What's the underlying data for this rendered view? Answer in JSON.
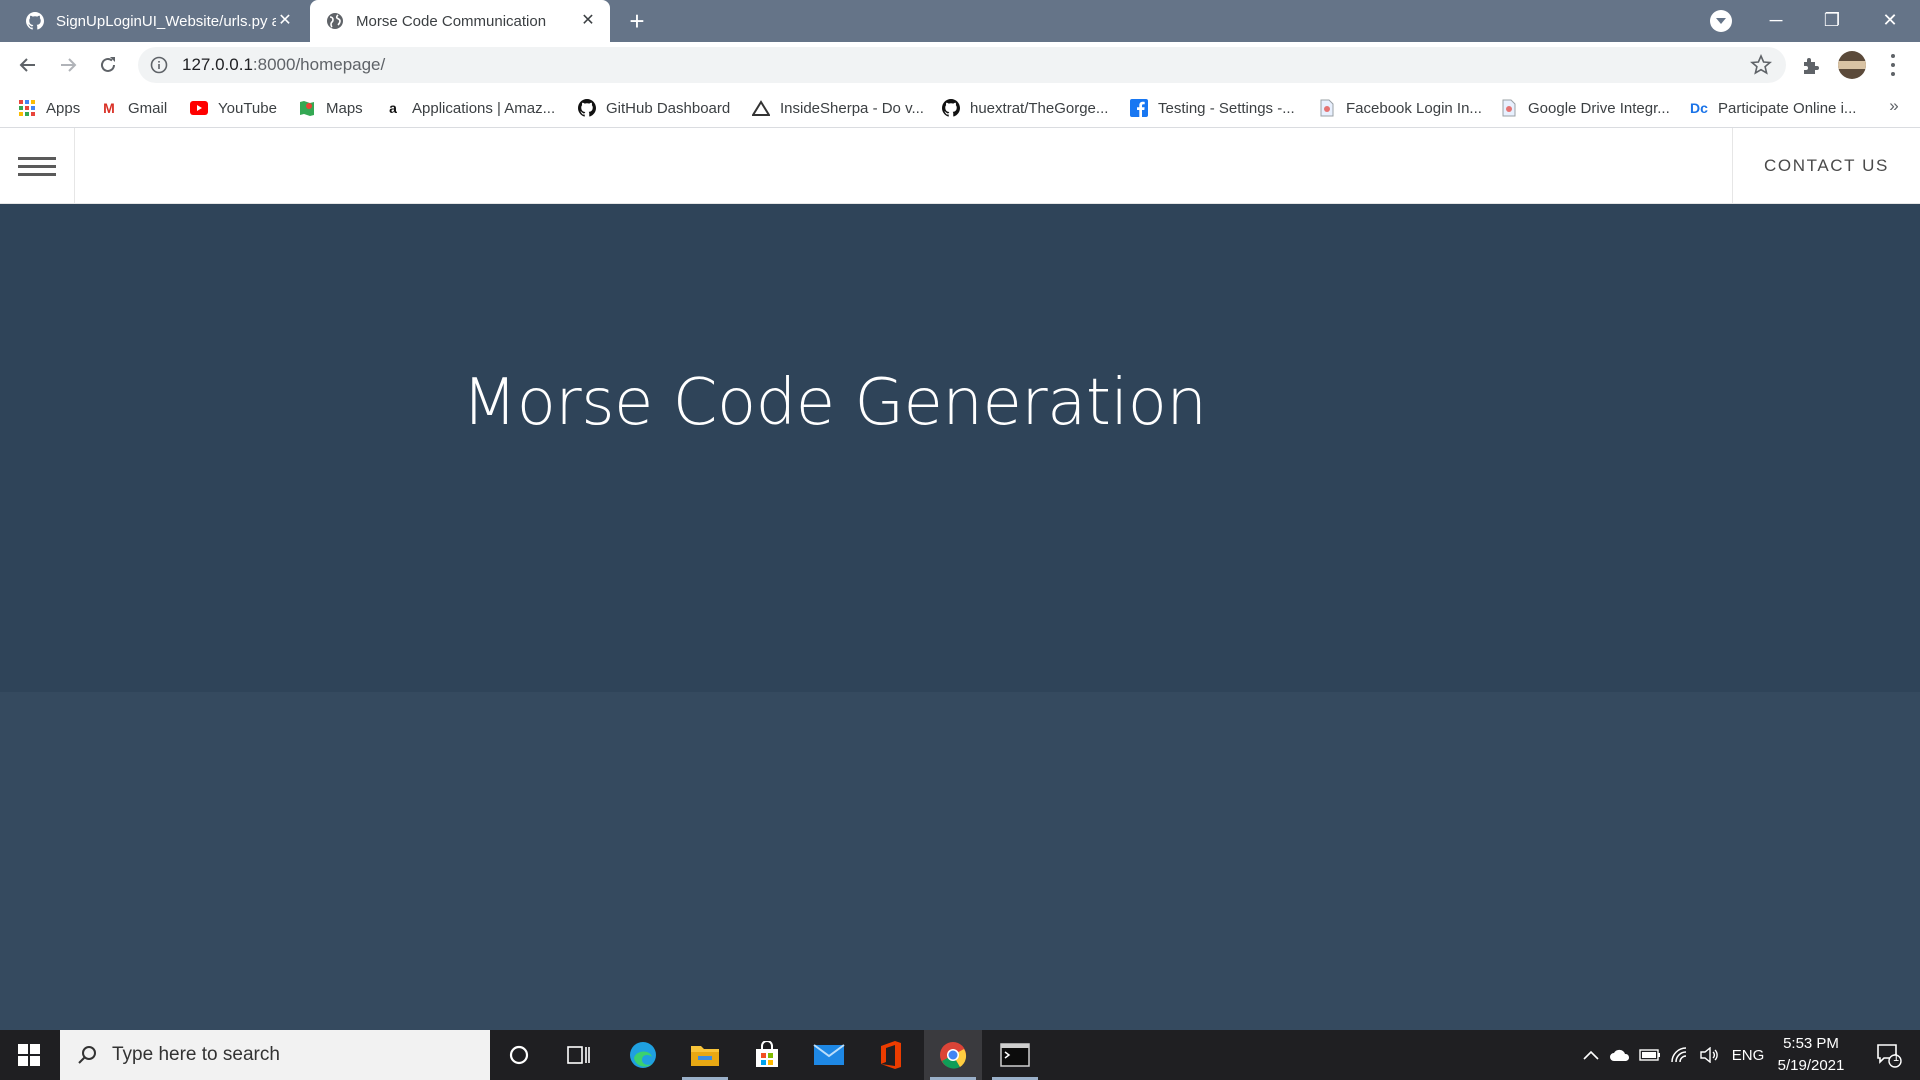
{
  "browser": {
    "tabs": [
      {
        "title": "SignUpLoginUI_Website/urls.py at",
        "active": false
      },
      {
        "title": "Morse Code Communication",
        "active": true
      }
    ],
    "new_tab_label": "+",
    "address": {
      "host": "127.0.0.1",
      "path": ":8000/homepage/"
    },
    "bookmarks": [
      {
        "label": "Apps",
        "icon": "apps-grid-icon"
      },
      {
        "label": "Gmail",
        "icon": "gmail-icon"
      },
      {
        "label": "YouTube",
        "icon": "youtube-icon"
      },
      {
        "label": "Maps",
        "icon": "maps-icon"
      },
      {
        "label": "Applications | Amaz...",
        "icon": "amazon-icon"
      },
      {
        "label": "GitHub Dashboard",
        "icon": "github-icon"
      },
      {
        "label": "InsideSherpa - Do v...",
        "icon": "insidesherpa-icon"
      },
      {
        "label": "huextrat/TheGorge...",
        "icon": "github-icon"
      },
      {
        "label": "Testing - Settings -...",
        "icon": "facebook-icon"
      },
      {
        "label": "Facebook Login In...",
        "icon": "doc-icon"
      },
      {
        "label": "Google Drive Integr...",
        "icon": "doc-icon"
      },
      {
        "label": "Participate Online i...",
        "icon": "dc-icon"
      }
    ],
    "bookmarks_more": "»"
  },
  "site": {
    "contact_label": "CONTACT US",
    "hero_title": "Morse Code Generation"
  },
  "taskbar": {
    "search_placeholder": "Type here to search",
    "tray_language": "ENG",
    "time": "5:53 PM",
    "date": "5/19/2021",
    "notification_count": "1"
  },
  "colors": {
    "tabstrip": "#657488",
    "hero_bg": "#2f4459",
    "lower_bg": "#354a5f",
    "taskbar": "#1f1f22"
  }
}
